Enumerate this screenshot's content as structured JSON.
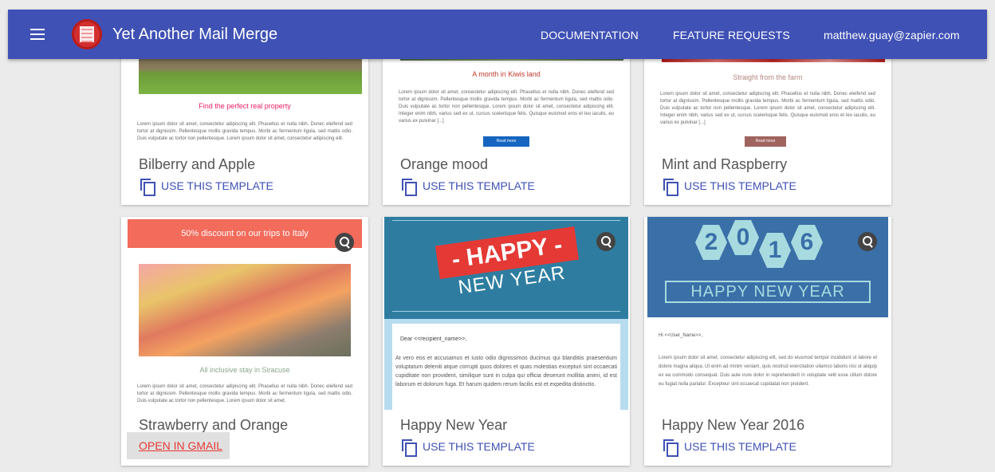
{
  "app": {
    "title": "Yet Another Mail Merge",
    "nav": {
      "documentation": "DOCUMENTATION",
      "feature_requests": "FEATURE REQUESTS",
      "user_email": "matthew.guay@zapier.com"
    }
  },
  "templates": [
    {
      "title": "Bilberry and Apple",
      "action": "USE THIS TEMPLATE",
      "preview_heading": "Find the perfect real property",
      "preview_body": "Lorem ipsum dolor sit amet, consectetur adipiscing elit. Phasellus et nulla nibh. Donec eleifend sed tortor at dignissim. Pellentesque mollis gravida tempus. Morbi ac fermentum ligula, sed mattis odio. Duis vulputate ac tortor non pellentesque. Lorem ipsum dolor sit amet, consectetur adipiscing elit."
    },
    {
      "title": "Orange mood",
      "action": "USE THIS TEMPLATE",
      "preview_heading": "A month in Kiwis land",
      "preview_body": "Lorem ipsum dolor sit amet, consectetur adipiscing elit. Phasellus et nulla nibh. Donec eleifend sed tortor at dignissim. Pellentesque mollis gravida tempus. Morbi ac fermentum ligula, sed mattis odio. Duis vulputate ac tortor non pellentesque. Lorem ipsum dolor sit amet, consectetur adipiscing elit. Integer enim nibh, varius sed ex ut, cursus scelerisque felis. Quisque euismod eros et leo iaculis, eu varius ex pulvinar [...]",
      "preview_button": "Read more"
    },
    {
      "title": "Mint and Raspberry",
      "action": "USE THIS TEMPLATE",
      "preview_heading": "Straight from the farm",
      "preview_body": "Lorem ipsum dolor sit amet, consectetur adipiscing elit. Phasellus et nulla nibh. Donec eleifend sed tortor at dignissim. Pellentesque mollis gravida tempus. Morbi ac fermentum ligula, sed mattis odio. Duis vulputate ac tortor non pellentesque. Lorem ipsum dolor sit amet, consectetur adipiscing elit. Integer enim nibh, varius sed ex ut, cursus scelerisque felis. Quisque euismod eros et leo iaculis, eu varius ex pulvinar [...]",
      "preview_button": "Read more"
    },
    {
      "title": "Strawberry and Orange",
      "action": "OPEN IN GMAIL",
      "preview_banner": "50% discount on our trips to Italy",
      "preview_heading": "All inclusive stay in Siracuse",
      "preview_body": "Lorem ipsum dolor sit amet, consectetur adipiscing elit. Phasellus et nulla nibh. Donec eleifend sed tortor at dignissim. Pellentesque mollis gravida tempus. Morbi ac fermentum ligula, sed mattis odio. Duis vulputate ac tortor non pellentesque. Lorem ipsum dolor sit amet."
    },
    {
      "title": "Happy New Year",
      "action": "USE THIS TEMPLATE",
      "preview_banner_top": "- HAPPY -",
      "preview_banner_bottom": "NEW YEAR",
      "preview_greeting": "Dear <<recipient_name>>,",
      "preview_body": "At vero eos et accusamus et iusto odio dignissimos ducimus qui blanditiis praesentium voluptatum deleniti atque corrupti quos dolores et quas molestias excepturi sint occaecati cupiditate non provident, similique sunt in culpa qui officia deserunt mollitia animi, id est laborum et dolorum fuga. Et harum quidem rerum facilis est et expedita distinctio."
    },
    {
      "title": "Happy New Year 2016",
      "action": "USE THIS TEMPLATE",
      "preview_digits": [
        "2",
        "0",
        "1",
        "6"
      ],
      "preview_banner": "HAPPY NEW YEAR",
      "preview_greeting": "Hi <<User_Name>>,",
      "preview_body": "Lorem ipsum dolor sit amet, consectetur adipiscing elit, sed do eiusmod tempor incididunt ut labore et dolore magna aliqua. Ut enim ad minim veniam, quis nostrud exercitation ullamco laboris nisi ut aliquip ex ea commodo consequat. Duis aute irure dolor in reprehenderit in voluptate velit esse cillum dolore eu fugiat nulla pariatur. Excepteur sint occaecat cupidatat non proident."
    }
  ],
  "colors": {
    "appbar": "#3f51b5",
    "action_text": "#3f51b5",
    "gmail_link": "#e53935"
  }
}
